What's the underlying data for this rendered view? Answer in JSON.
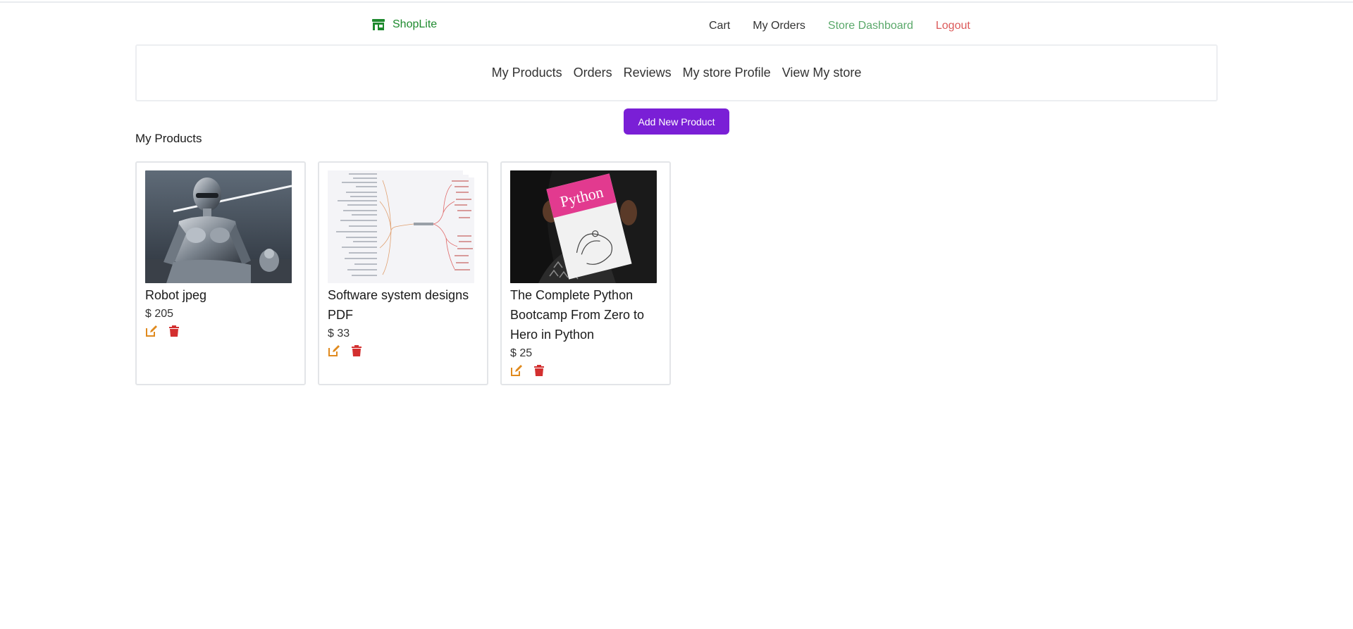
{
  "header": {
    "brand_name": "ShopLite",
    "brand_icon": "store-icon",
    "nav": [
      "Cart",
      "My Orders",
      "Store Dashboard",
      "Logout"
    ]
  },
  "store_nav": [
    "My Products",
    "Orders",
    "Reviews",
    "My store Profile",
    "View My store"
  ],
  "add_button_label": "Add New Product",
  "section_title": "My Products",
  "products": [
    {
      "title": "Robot jpeg",
      "price": "$ 205"
    },
    {
      "title": "Software system designs PDF",
      "price": "$ 33"
    },
    {
      "title": "The Complete Python Bootcamp From Zero to Hero in Python",
      "price": "$ 25",
      "cover_text": "Python"
    }
  ],
  "action_icons": [
    "edit-icon",
    "trash-icon"
  ],
  "colors": {
    "brand": "#1e8a2e",
    "dashboard_link": "#5aa86a",
    "logout_link": "#dc5a5a",
    "primary_button": "#7a1fd6",
    "edit_icon": "#e08a1e",
    "delete_icon": "#d32f2f"
  }
}
